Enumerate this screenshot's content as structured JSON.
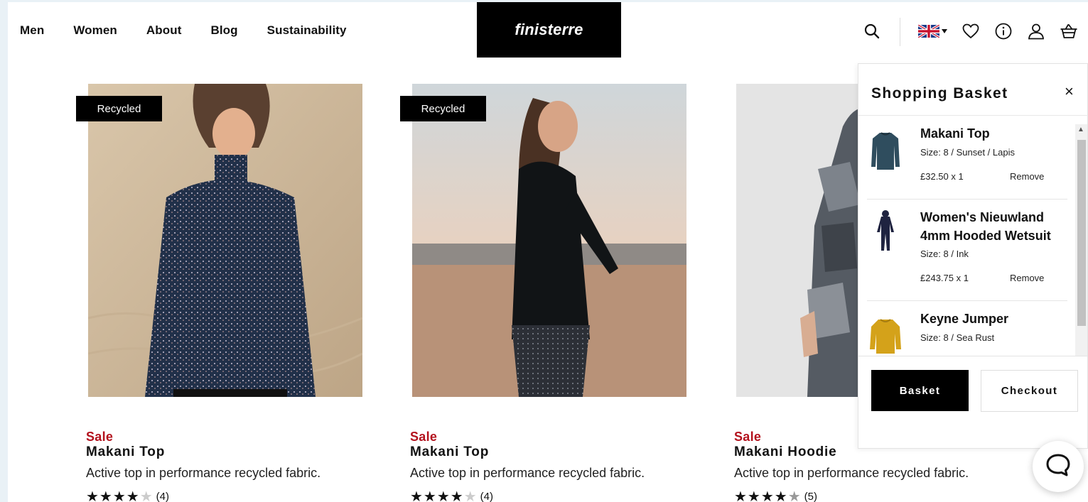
{
  "header": {
    "nav": [
      "Men",
      "Women",
      "About",
      "Blog",
      "Sustainability"
    ],
    "logo": "finisterre",
    "icons": [
      "search-icon",
      "uk-flag-icon",
      "heart-icon",
      "info-icon",
      "account-icon",
      "basket-icon"
    ]
  },
  "products": [
    {
      "badge": "Recycled",
      "sale": "Sale",
      "name": "Makani Top",
      "desc": "Active top in performance recycled fabric.",
      "rating": 4,
      "count": "(4)"
    },
    {
      "badge": "Recycled",
      "sale": "Sale",
      "name": "Makani Top",
      "desc": "Active top in performance recycled fabric.",
      "rating": 4,
      "count": "(4)"
    },
    {
      "badge": "",
      "sale": "Sale",
      "name": "Makani Hoodie",
      "desc": "Active top in performance recycled fabric.",
      "rating": 4.5,
      "count": "(5)"
    }
  ],
  "basket": {
    "title": "Shopping Basket",
    "close": "×",
    "items": [
      {
        "name": "Makani Top",
        "size": "Size: 8 / Sunset / Lapis",
        "price": "£32.50 x 1",
        "remove": "Remove"
      },
      {
        "name": "Women's Nieuwland 4mm Hooded Wetsuit",
        "size": "Size: 8 / Ink",
        "price": "£243.75 x 1",
        "remove": "Remove"
      },
      {
        "name": "Keyne Jumper",
        "size": "Size: 8 / Sea Rust",
        "price": "",
        "remove": ""
      }
    ],
    "basket_button": "Basket",
    "checkout_button": "Checkout"
  },
  "colors": {
    "sale": "#b3121d",
    "accent": "#000000",
    "page_bg": "#e9f1f6"
  }
}
